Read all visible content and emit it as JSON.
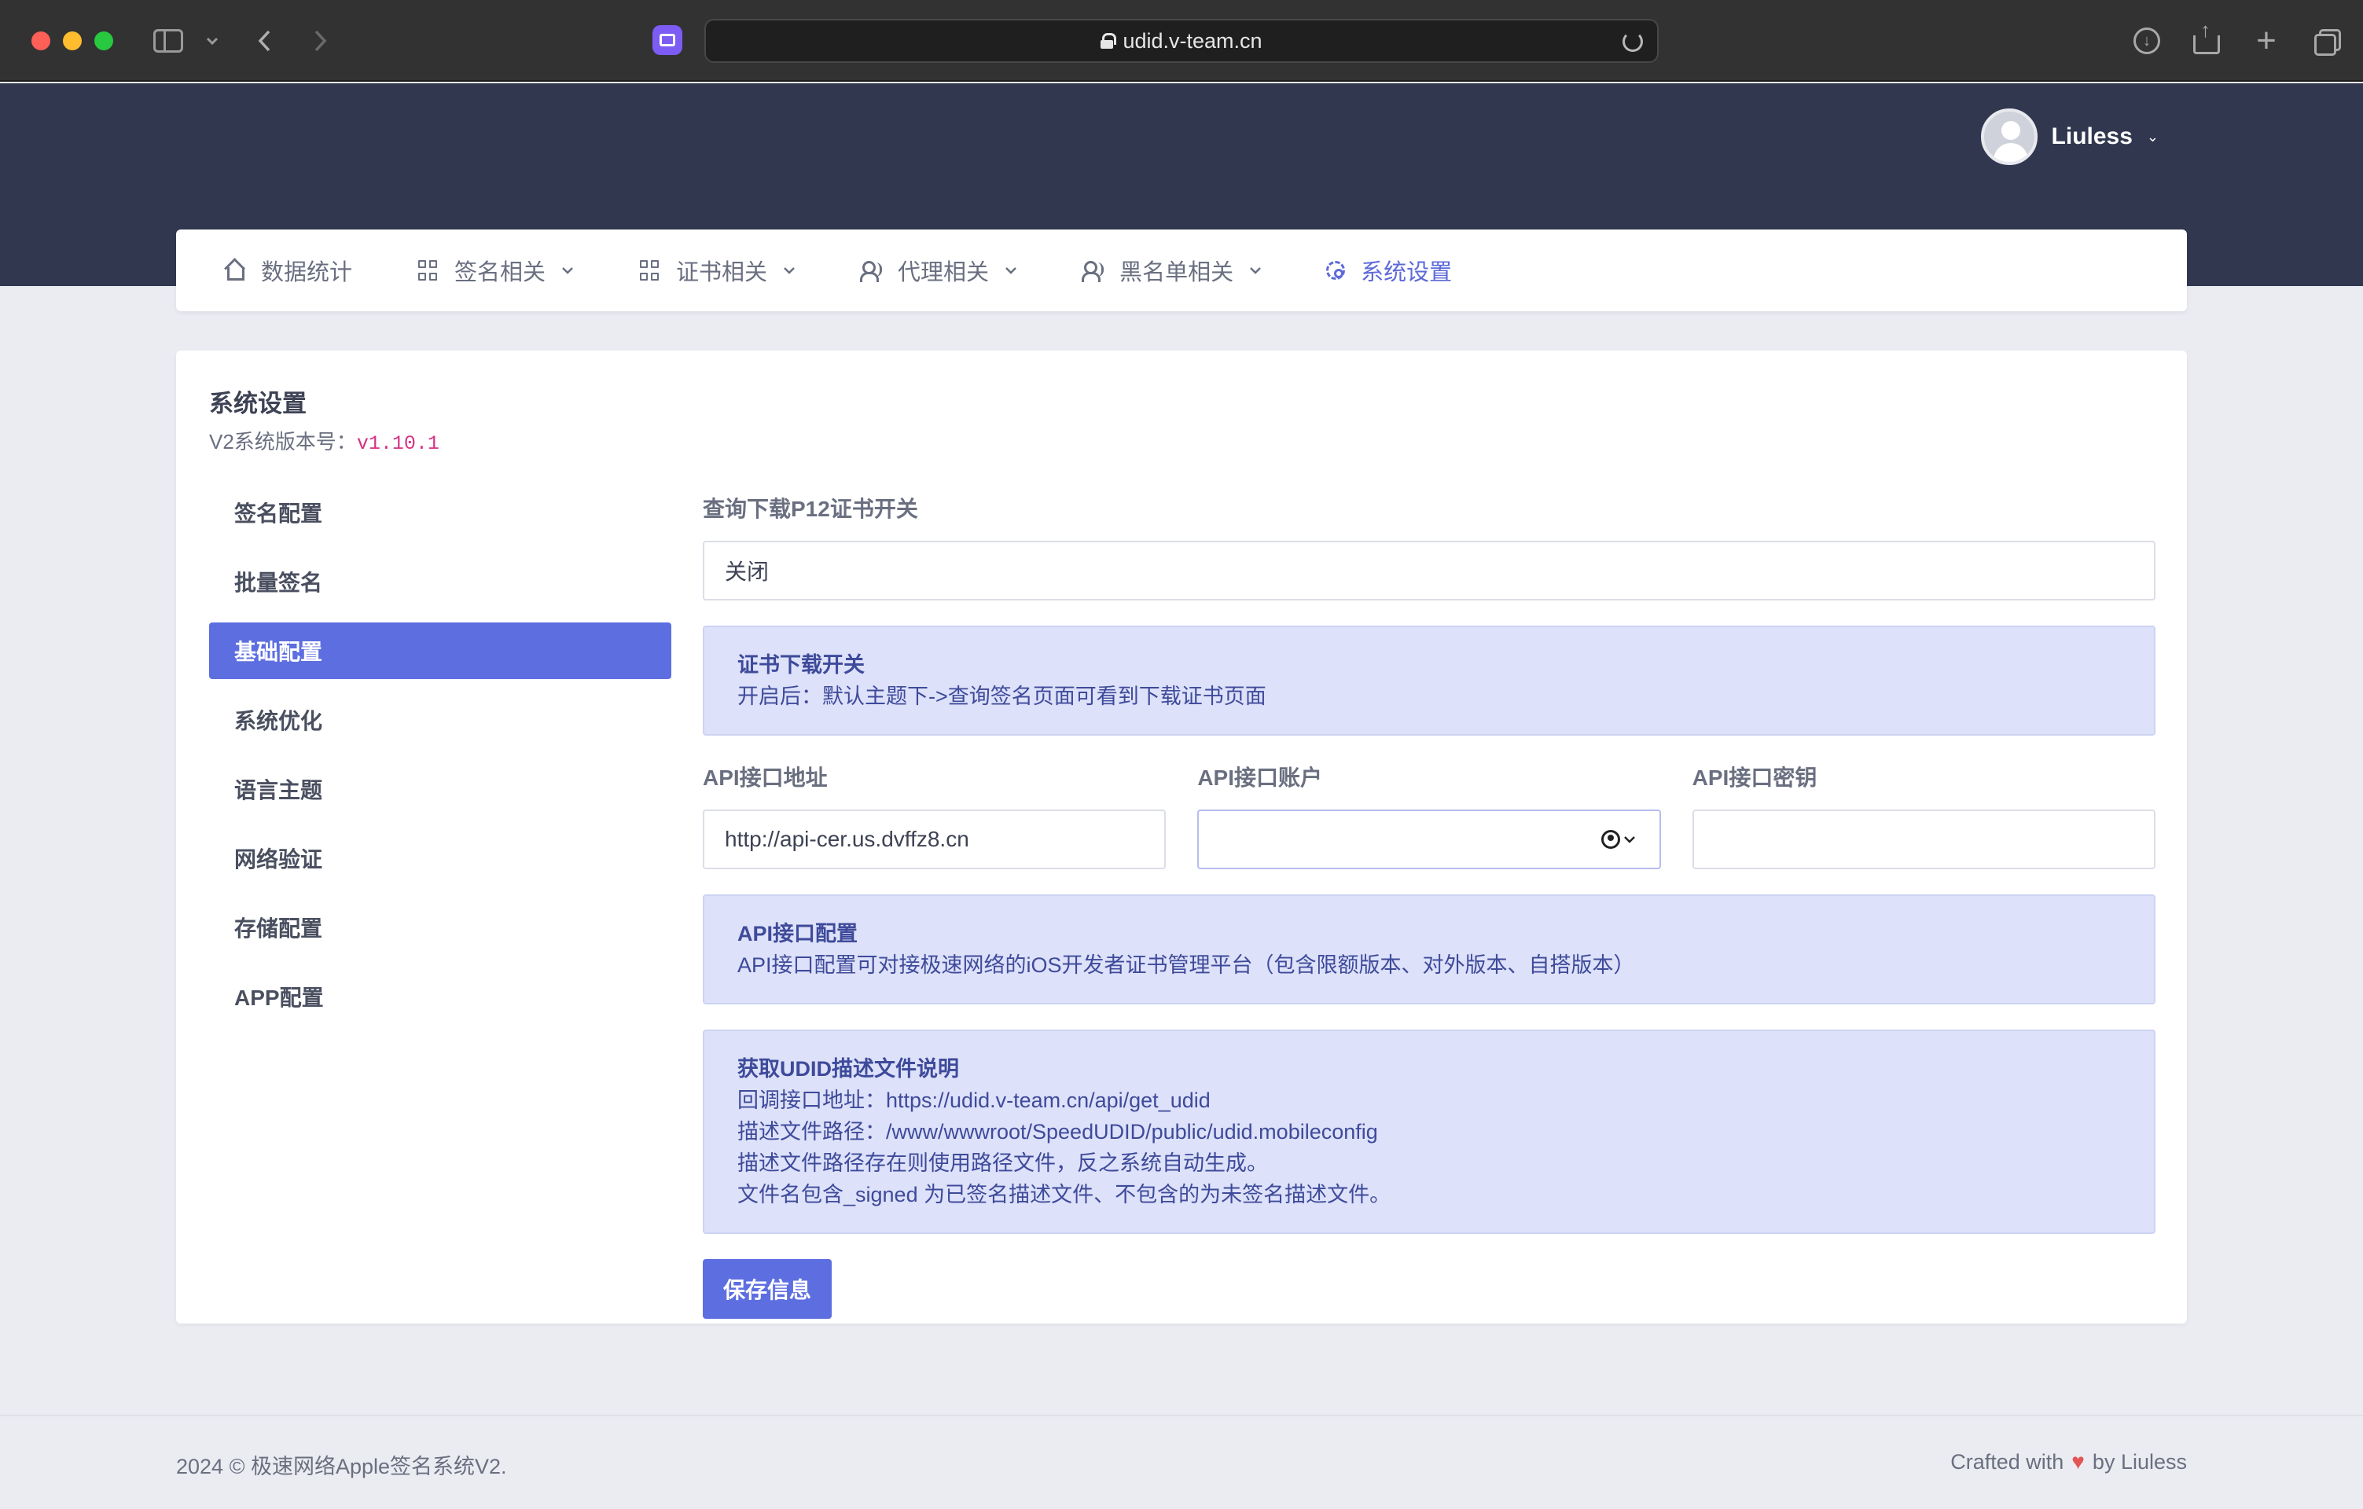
{
  "browser": {
    "url": "udid.v-team.cn"
  },
  "header": {
    "user_name": "Liuless"
  },
  "nav": {
    "items": [
      {
        "label": "数据统计",
        "icon": "home-icon",
        "has_dropdown": false
      },
      {
        "label": "签名相关",
        "icon": "grid-icon",
        "has_dropdown": true
      },
      {
        "label": "证书相关",
        "icon": "grid-icon",
        "has_dropdown": true
      },
      {
        "label": "代理相关",
        "icon": "users-icon",
        "has_dropdown": true
      },
      {
        "label": "黑名单相关",
        "icon": "users-icon",
        "has_dropdown": true
      },
      {
        "label": "系统设置",
        "icon": "gear-icon",
        "has_dropdown": false,
        "active": true
      }
    ]
  },
  "page": {
    "title": "系统设置",
    "version_label": "V2系统版本号：",
    "version_value": "v1.10.1"
  },
  "side_menu": {
    "items": [
      {
        "label": "签名配置"
      },
      {
        "label": "批量签名"
      },
      {
        "label": "基础配置",
        "active": true
      },
      {
        "label": "系统优化"
      },
      {
        "label": "语言主题"
      },
      {
        "label": "网络验证"
      },
      {
        "label": "存储配置"
      },
      {
        "label": "APP配置"
      }
    ]
  },
  "form": {
    "p12_switch": {
      "label": "查询下载P12证书开关",
      "value": "关闭"
    },
    "cert_info": {
      "title": "证书下载开关",
      "text": "开启后：默认主题下->查询签名页面可看到下载证书页面"
    },
    "api_url": {
      "label": "API接口地址",
      "value": "http://api-cer.us.dvffz8.cn"
    },
    "api_account": {
      "label": "API接口账户",
      "value": ""
    },
    "api_key": {
      "label": "API接口密钥",
      "value": ""
    },
    "api_info": {
      "title": "API接口配置",
      "text": "API接口配置可对接极速网络的iOS开发者证书管理平台（包含限额版本、对外版本、自搭版本）"
    },
    "udid_info": {
      "title": "获取UDID描述文件说明",
      "line1": "回调接口地址：https://udid.v-team.cn/api/get_udid",
      "line2": "描述文件路径：/www/wwwroot/SpeedUDID/public/udid.mobileconfig",
      "line3": "描述文件路径存在则使用路径文件，反之系统自动生成。",
      "line4": "文件名包含_signed 为已签名描述文件、不包含的为未签名描述文件。"
    },
    "save_label": "保存信息"
  },
  "footer": {
    "left": "2024 © 极速网络Apple签名系统V2.",
    "right_prefix": "Crafted with",
    "right_suffix": "by Liuless"
  },
  "colors": {
    "header_bg": "#31374f",
    "accent": "#5d6ee0",
    "info_bg": "#dde1f9",
    "version_code": "#d63384"
  }
}
